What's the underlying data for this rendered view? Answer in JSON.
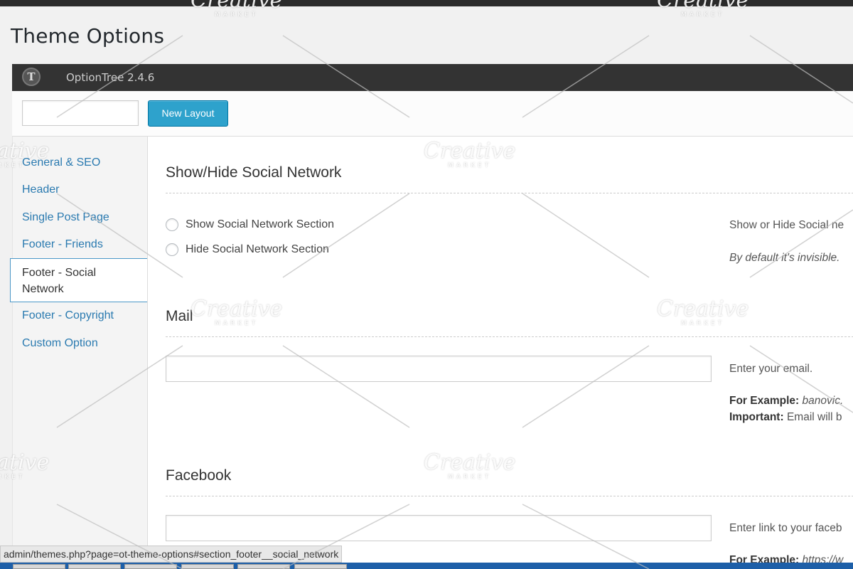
{
  "page_title": "Theme Options",
  "optiontree": {
    "logo_glyph": "T",
    "version_label": "OptionTree 2.4.6"
  },
  "toolbar": {
    "layout_input_value": "",
    "new_layout_label": "New Layout"
  },
  "sidebar": {
    "items": [
      {
        "label": "General & SEO"
      },
      {
        "label": "Header"
      },
      {
        "label": "Single Post Page"
      },
      {
        "label": "Footer - Friends"
      },
      {
        "label": "Footer - Social Network"
      },
      {
        "label": "Footer - Copyright"
      },
      {
        "label": "Custom Option"
      }
    ],
    "active_index": 4
  },
  "sections": {
    "show_hide": {
      "title": "Show/Hide Social Network",
      "options": [
        "Show Social Network Section",
        "Hide Social Network Section"
      ],
      "desc": "Show or Hide Social ne",
      "desc_note": "By default it's invisible."
    },
    "mail": {
      "title": "Mail",
      "value": "",
      "desc": "Enter your email.",
      "example_label": "For Example:",
      "example_value": "banovic.",
      "important_label": "Important:",
      "important_value": "Email will b"
    },
    "facebook": {
      "title": "Facebook",
      "value": "",
      "desc": "Enter link to your faceb",
      "example_label": "For Example:",
      "example_value": "https://w"
    }
  },
  "status_url": "admin/themes.php?page=ot-theme-options#section_footer__social_network",
  "watermark": {
    "brand": "Creative",
    "sub": "MARKET"
  },
  "colors": {
    "accent": "#2ea2cc",
    "link": "#2a7ab0",
    "header_bg": "#333333"
  }
}
